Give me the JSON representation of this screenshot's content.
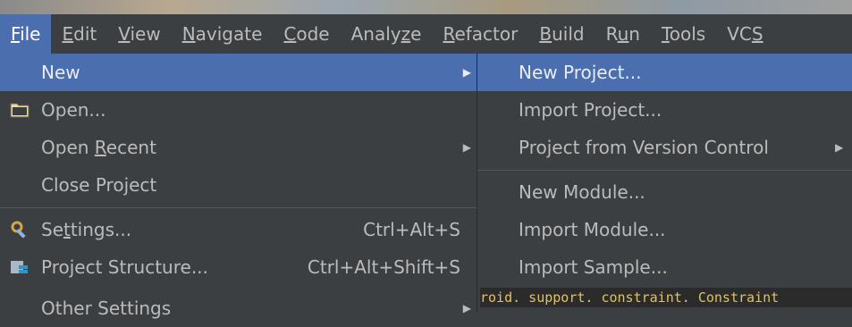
{
  "menubar": {
    "items": [
      {
        "pre": "",
        "mn": "F",
        "post": "ile"
      },
      {
        "pre": "",
        "mn": "E",
        "post": "dit"
      },
      {
        "pre": "",
        "mn": "V",
        "post": "iew"
      },
      {
        "pre": "",
        "mn": "N",
        "post": "avigate"
      },
      {
        "pre": "",
        "mn": "C",
        "post": "ode"
      },
      {
        "pre": "Analy",
        "mn": "z",
        "post": "e"
      },
      {
        "pre": "",
        "mn": "R",
        "post": "efactor"
      },
      {
        "pre": "",
        "mn": "B",
        "post": "uild"
      },
      {
        "pre": "R",
        "mn": "u",
        "post": "n"
      },
      {
        "pre": "",
        "mn": "T",
        "post": "ools"
      },
      {
        "pre": "VC",
        "mn": "S",
        "post": ""
      }
    ]
  },
  "file_menu": {
    "new": "New",
    "open": "Open...",
    "open_recent_pre": "Open ",
    "open_recent_mn": "R",
    "open_recent_post": "ecent",
    "close_project": "Close Project",
    "settings_pre": "Se",
    "settings_mn": "t",
    "settings_post": "tings...",
    "settings_shortcut": "Ctrl+Alt+S",
    "project_structure": "Project Structure...",
    "project_structure_shortcut": "Ctrl+Alt+Shift+S",
    "other_settings": "Other Settings"
  },
  "new_submenu": {
    "new_project": "New Project...",
    "import_project": "Import Project...",
    "project_from_vcs": "Project from Version Control",
    "new_module": "New Module...",
    "import_module": "Import Module...",
    "import_sample": "Import Sample..."
  },
  "editor": {
    "code_line": "roid. support. constraint. Constraint"
  },
  "icons": {
    "folder": "folder-icon",
    "settings": "wrench-gear-icon",
    "project_structure": "project-structure-icon",
    "submenu_arrow": "triangle-right-icon"
  },
  "colors": {
    "menu_bg": "#3c3f41",
    "selection": "#4b6eaf",
    "text": "#bbbbbb",
    "code_text": "#e2c066"
  }
}
